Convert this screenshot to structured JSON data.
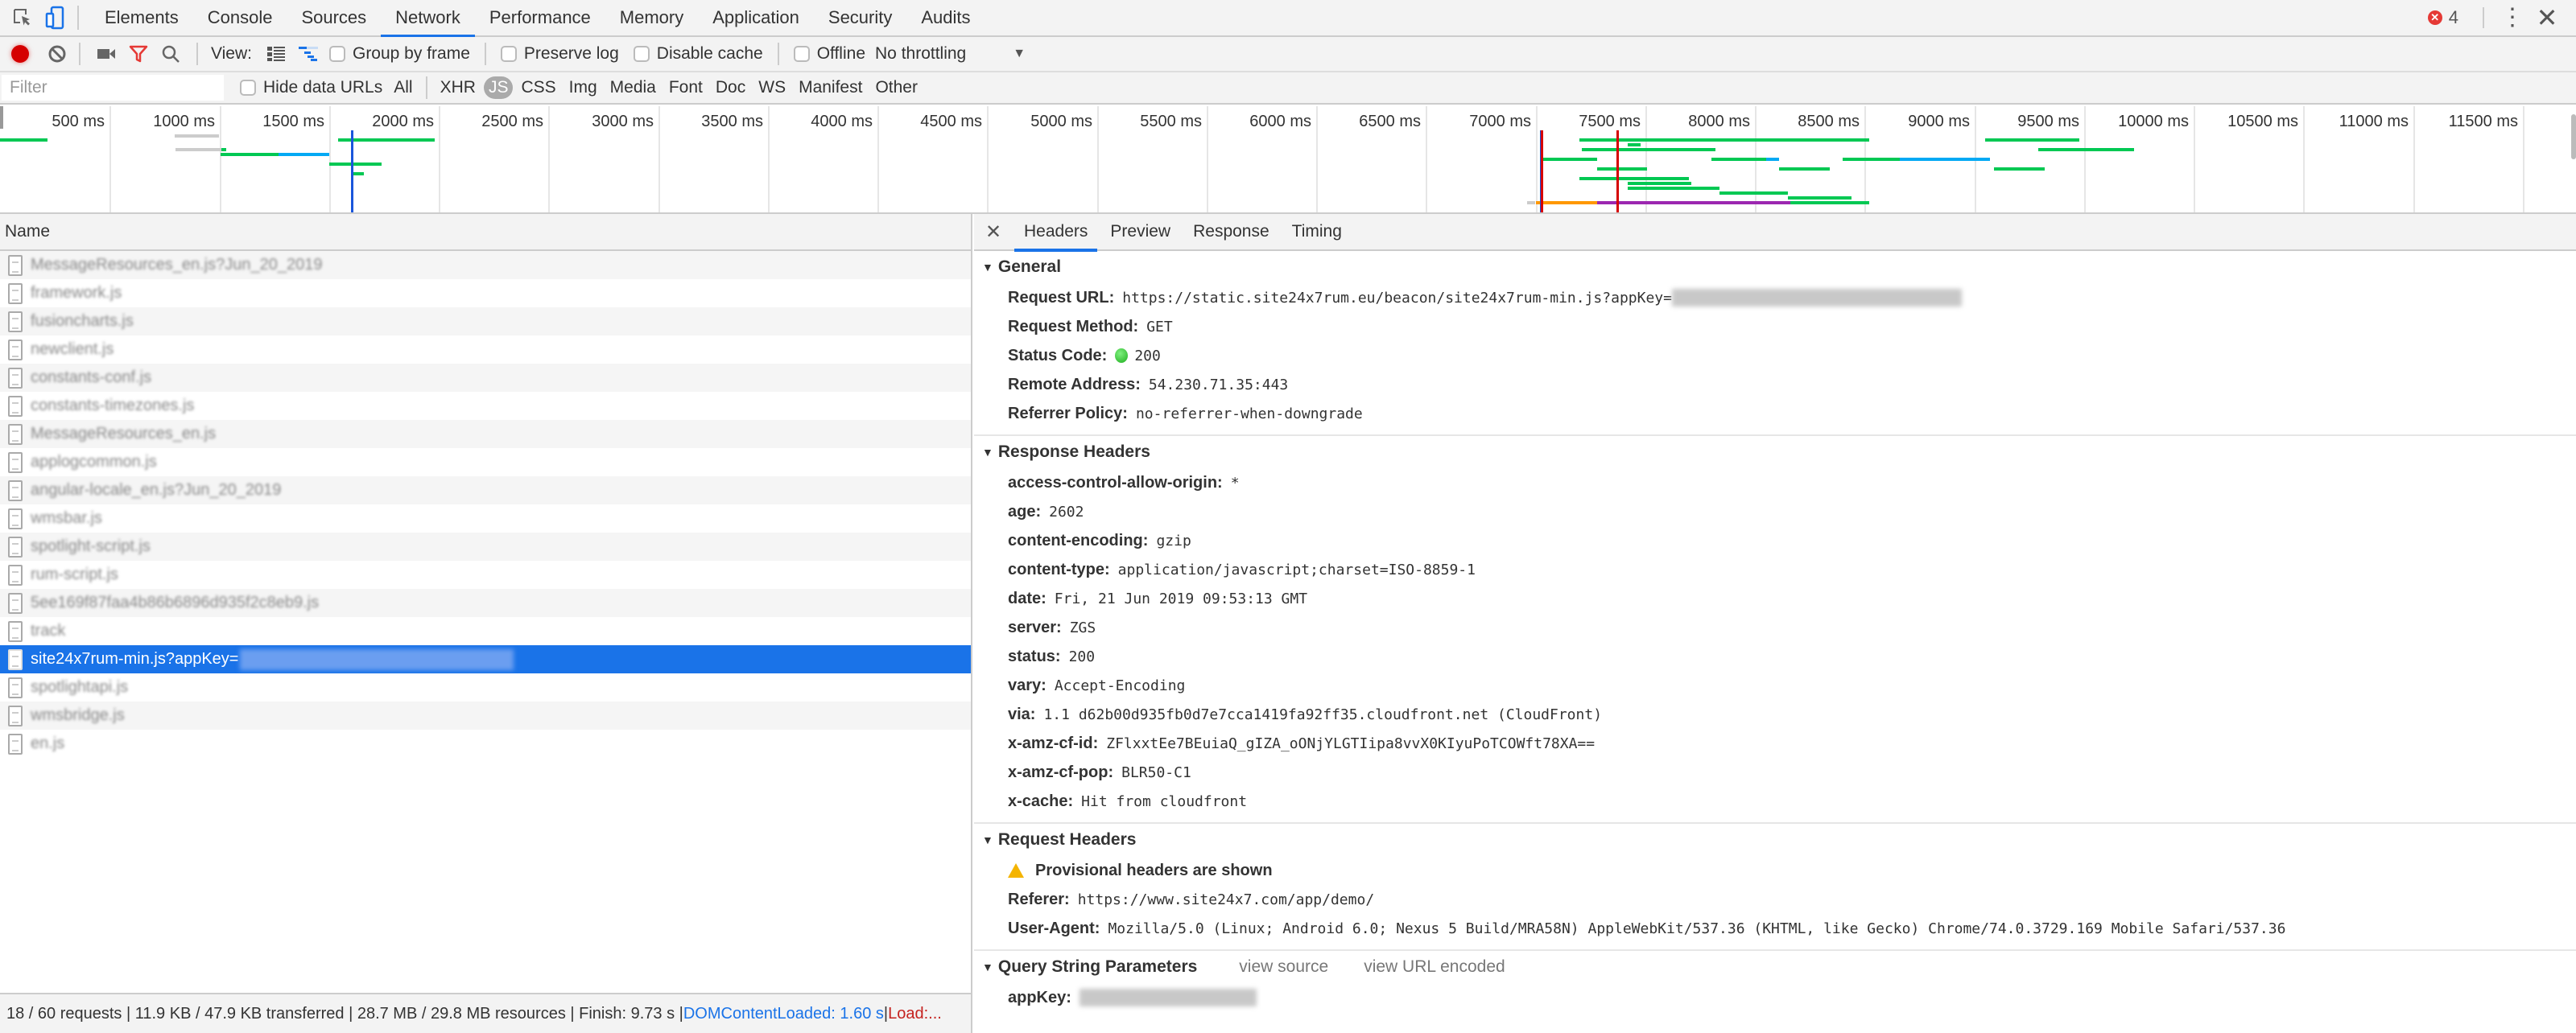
{
  "devtools": {
    "tabs": [
      "Elements",
      "Console",
      "Sources",
      "Network",
      "Performance",
      "Memory",
      "Application",
      "Security",
      "Audits"
    ],
    "active_tab": "Network",
    "error_count": "4"
  },
  "toolbar": {
    "view_label": "View:",
    "group_by_frame": "Group by frame",
    "preserve_log": "Preserve log",
    "disable_cache": "Disable cache",
    "offline": "Offline",
    "throttling": "No throttling"
  },
  "filterbar": {
    "placeholder": "Filter",
    "hide_data_urls": "Hide data URLs",
    "types": [
      "All",
      "XHR",
      "JS",
      "CSS",
      "Img",
      "Media",
      "Font",
      "Doc",
      "WS",
      "Manifest",
      "Other"
    ],
    "active_type": "JS"
  },
  "overview": {
    "ticks": [
      "500 ms",
      "1000 ms",
      "1500 ms",
      "2000 ms",
      "2500 ms",
      "3000 ms",
      "3500 ms",
      "4000 ms",
      "4500 ms",
      "5000 ms",
      "5500 ms",
      "6000 ms",
      "6500 ms",
      "7000 ms",
      "7500 ms",
      "8000 ms",
      "8500 ms",
      "9000 ms",
      "9500 ms",
      "10000 ms",
      "10500 ms",
      "11000 ms",
      "11500 ms"
    ],
    "colors": {
      "waiting": "#00c853",
      "download": "#03a9f4",
      "queued": "#cccccc",
      "dom": "#1a56db",
      "load": "#d50000",
      "stalled": "#ff9800",
      "ssl": "#9c27b0"
    },
    "dom_content_loaded_ms": 1600,
    "load_ms_markers": [
      7020,
      7370
    ]
  },
  "request_list": {
    "column_name": "Name",
    "rows": [
      "MessageResources_en.js?Jun_20_2019",
      "framework.js",
      "fusioncharts.js",
      "newclient.js",
      "constants-conf.js",
      "constants-timezones.js",
      "MessageResources_en.js",
      "applogcommon.js",
      "angular-locale_en.js?Jun_20_2019",
      "wmsbar.js",
      "spotlight-script.js",
      "rum-script.js",
      "5ee169f87faa4b86b6896d935f2c8eb9.js",
      "track",
      "site24x7rum-min.js?appKey=",
      "spotlightapi.js",
      "wmsbridge.js",
      "en.js"
    ],
    "selected_index": 14
  },
  "statusbar": {
    "summary": "18 / 60 requests | 11.9 KB / 47.9 KB transferred | 28.7 MB / 29.8 MB resources | Finish: 9.73 s | ",
    "dcl": "DOMContentLoaded: 1.60 s",
    "sep": " | ",
    "load": "Load:..."
  },
  "details": {
    "tabs": [
      "Headers",
      "Preview",
      "Response",
      "Timing"
    ],
    "active_tab": "Headers",
    "general": {
      "title": "General",
      "request_url_label": "Request URL:",
      "request_url": "https://static.site24x7rum.eu/beacon/site24x7rum-min.js?appKey=",
      "request_method_label": "Request Method:",
      "request_method": "GET",
      "status_code_label": "Status Code:",
      "status_code": "200",
      "remote_address_label": "Remote Address:",
      "remote_address": "54.230.71.35:443",
      "referrer_policy_label": "Referrer Policy:",
      "referrer_policy": "no-referrer-when-downgrade"
    },
    "response_headers": {
      "title": "Response Headers",
      "items": [
        {
          "k": "access-control-allow-origin:",
          "v": "*"
        },
        {
          "k": "age:",
          "v": "2602"
        },
        {
          "k": "content-encoding:",
          "v": "gzip"
        },
        {
          "k": "content-type:",
          "v": "application/javascript;charset=ISO-8859-1"
        },
        {
          "k": "date:",
          "v": "Fri, 21 Jun 2019 09:53:13 GMT"
        },
        {
          "k": "server:",
          "v": "ZGS"
        },
        {
          "k": "status:",
          "v": "200"
        },
        {
          "k": "vary:",
          "v": "Accept-Encoding"
        },
        {
          "k": "via:",
          "v": "1.1 d62b00d935fb0d7e7cca1419fa92ff35.cloudfront.net (CloudFront)"
        },
        {
          "k": "x-amz-cf-id:",
          "v": "ZFlxxtEe7BEuiaQ_gIZA_oONjYLGTIipa8vvX0KIyuPoTCOWft78XA=="
        },
        {
          "k": "x-amz-cf-pop:",
          "v": "BLR50-C1"
        },
        {
          "k": "x-cache:",
          "v": "Hit from cloudfront"
        }
      ]
    },
    "request_headers": {
      "title": "Request Headers",
      "warning": "Provisional headers are shown",
      "referer_label": "Referer:",
      "referer": "https://www.site24x7.com/app/demo/",
      "user_agent_label": "User-Agent:",
      "user_agent": "Mozilla/5.0 (Linux; Android 6.0; Nexus 5 Build/MRA58N) AppleWebKit/537.36 (KHTML, like Gecko) Chrome/74.0.3729.169 Mobile Safari/537.36"
    },
    "query_string": {
      "title": "Query String Parameters",
      "view_source": "view source",
      "view_url_encoded": "view URL encoded",
      "param_label": "appKey:"
    }
  },
  "waterfall_bars": [
    {
      "row": 0,
      "start": 0,
      "end": 215,
      "type": "waiting"
    },
    {
      "row": -1,
      "start": 795,
      "end": 1000,
      "type": "queued"
    },
    {
      "row": 2,
      "start": 800,
      "end": 1010,
      "type": "queued"
    },
    {
      "row": 2,
      "start": 1010,
      "end": 1030,
      "type": "waiting"
    },
    {
      "row": 3,
      "start": 1005,
      "end": 1270,
      "type": "waiting"
    },
    {
      "row": 3,
      "start": 1270,
      "end": 1500,
      "type": "download"
    },
    {
      "row": 5,
      "start": 1500,
      "end": 1740,
      "type": "waiting"
    },
    {
      "row": 0,
      "start": 1540,
      "end": 1980,
      "type": "waiting"
    },
    {
      "row": 7,
      "start": 1610,
      "end": 1660,
      "type": "waiting"
    },
    {
      "row": 0,
      "start": 7200,
      "end": 8520,
      "type": "waiting"
    },
    {
      "row": 1,
      "start": 7420,
      "end": 7480,
      "type": "waiting"
    },
    {
      "row": 2,
      "start": 7210,
      "end": 7820,
      "type": "waiting"
    },
    {
      "row": 4,
      "start": 7030,
      "end": 7280,
      "type": "waiting"
    },
    {
      "row": 4,
      "start": 7800,
      "end": 8050,
      "type": "waiting"
    },
    {
      "row": 4,
      "start": 8050,
      "end": 8110,
      "type": "download"
    },
    {
      "row": 4,
      "start": 8400,
      "end": 8660,
      "type": "waiting"
    },
    {
      "row": 4,
      "start": 8660,
      "end": 9070,
      "type": "download"
    },
    {
      "row": 6,
      "start": 7280,
      "end": 7510,
      "type": "waiting"
    },
    {
      "row": 6,
      "start": 8110,
      "end": 8340,
      "type": "waiting"
    },
    {
      "row": 6,
      "start": 9090,
      "end": 9320,
      "type": "waiting"
    },
    {
      "row": 0,
      "start": 9050,
      "end": 9480,
      "type": "waiting"
    },
    {
      "row": 2,
      "start": 9290,
      "end": 9730,
      "type": "waiting"
    },
    {
      "row": 8,
      "start": 7200,
      "end": 7700,
      "type": "waiting"
    },
    {
      "row": 9,
      "start": 7420,
      "end": 7710,
      "type": "waiting"
    },
    {
      "row": 10,
      "start": 7420,
      "end": 7840,
      "type": "waiting"
    },
    {
      "row": 11,
      "start": 7840,
      "end": 8150,
      "type": "waiting"
    },
    {
      "row": 12,
      "start": 8150,
      "end": 8440,
      "type": "waiting"
    },
    {
      "row": 13,
      "start": 6960,
      "end": 7000,
      "type": "queued"
    },
    {
      "row": 13,
      "start": 7000,
      "end": 7280,
      "type": "stalled"
    },
    {
      "row": 13,
      "start": 7280,
      "end": 8160,
      "type": "ssl"
    },
    {
      "row": 13,
      "start": 8160,
      "end": 8520,
      "type": "waiting"
    }
  ]
}
